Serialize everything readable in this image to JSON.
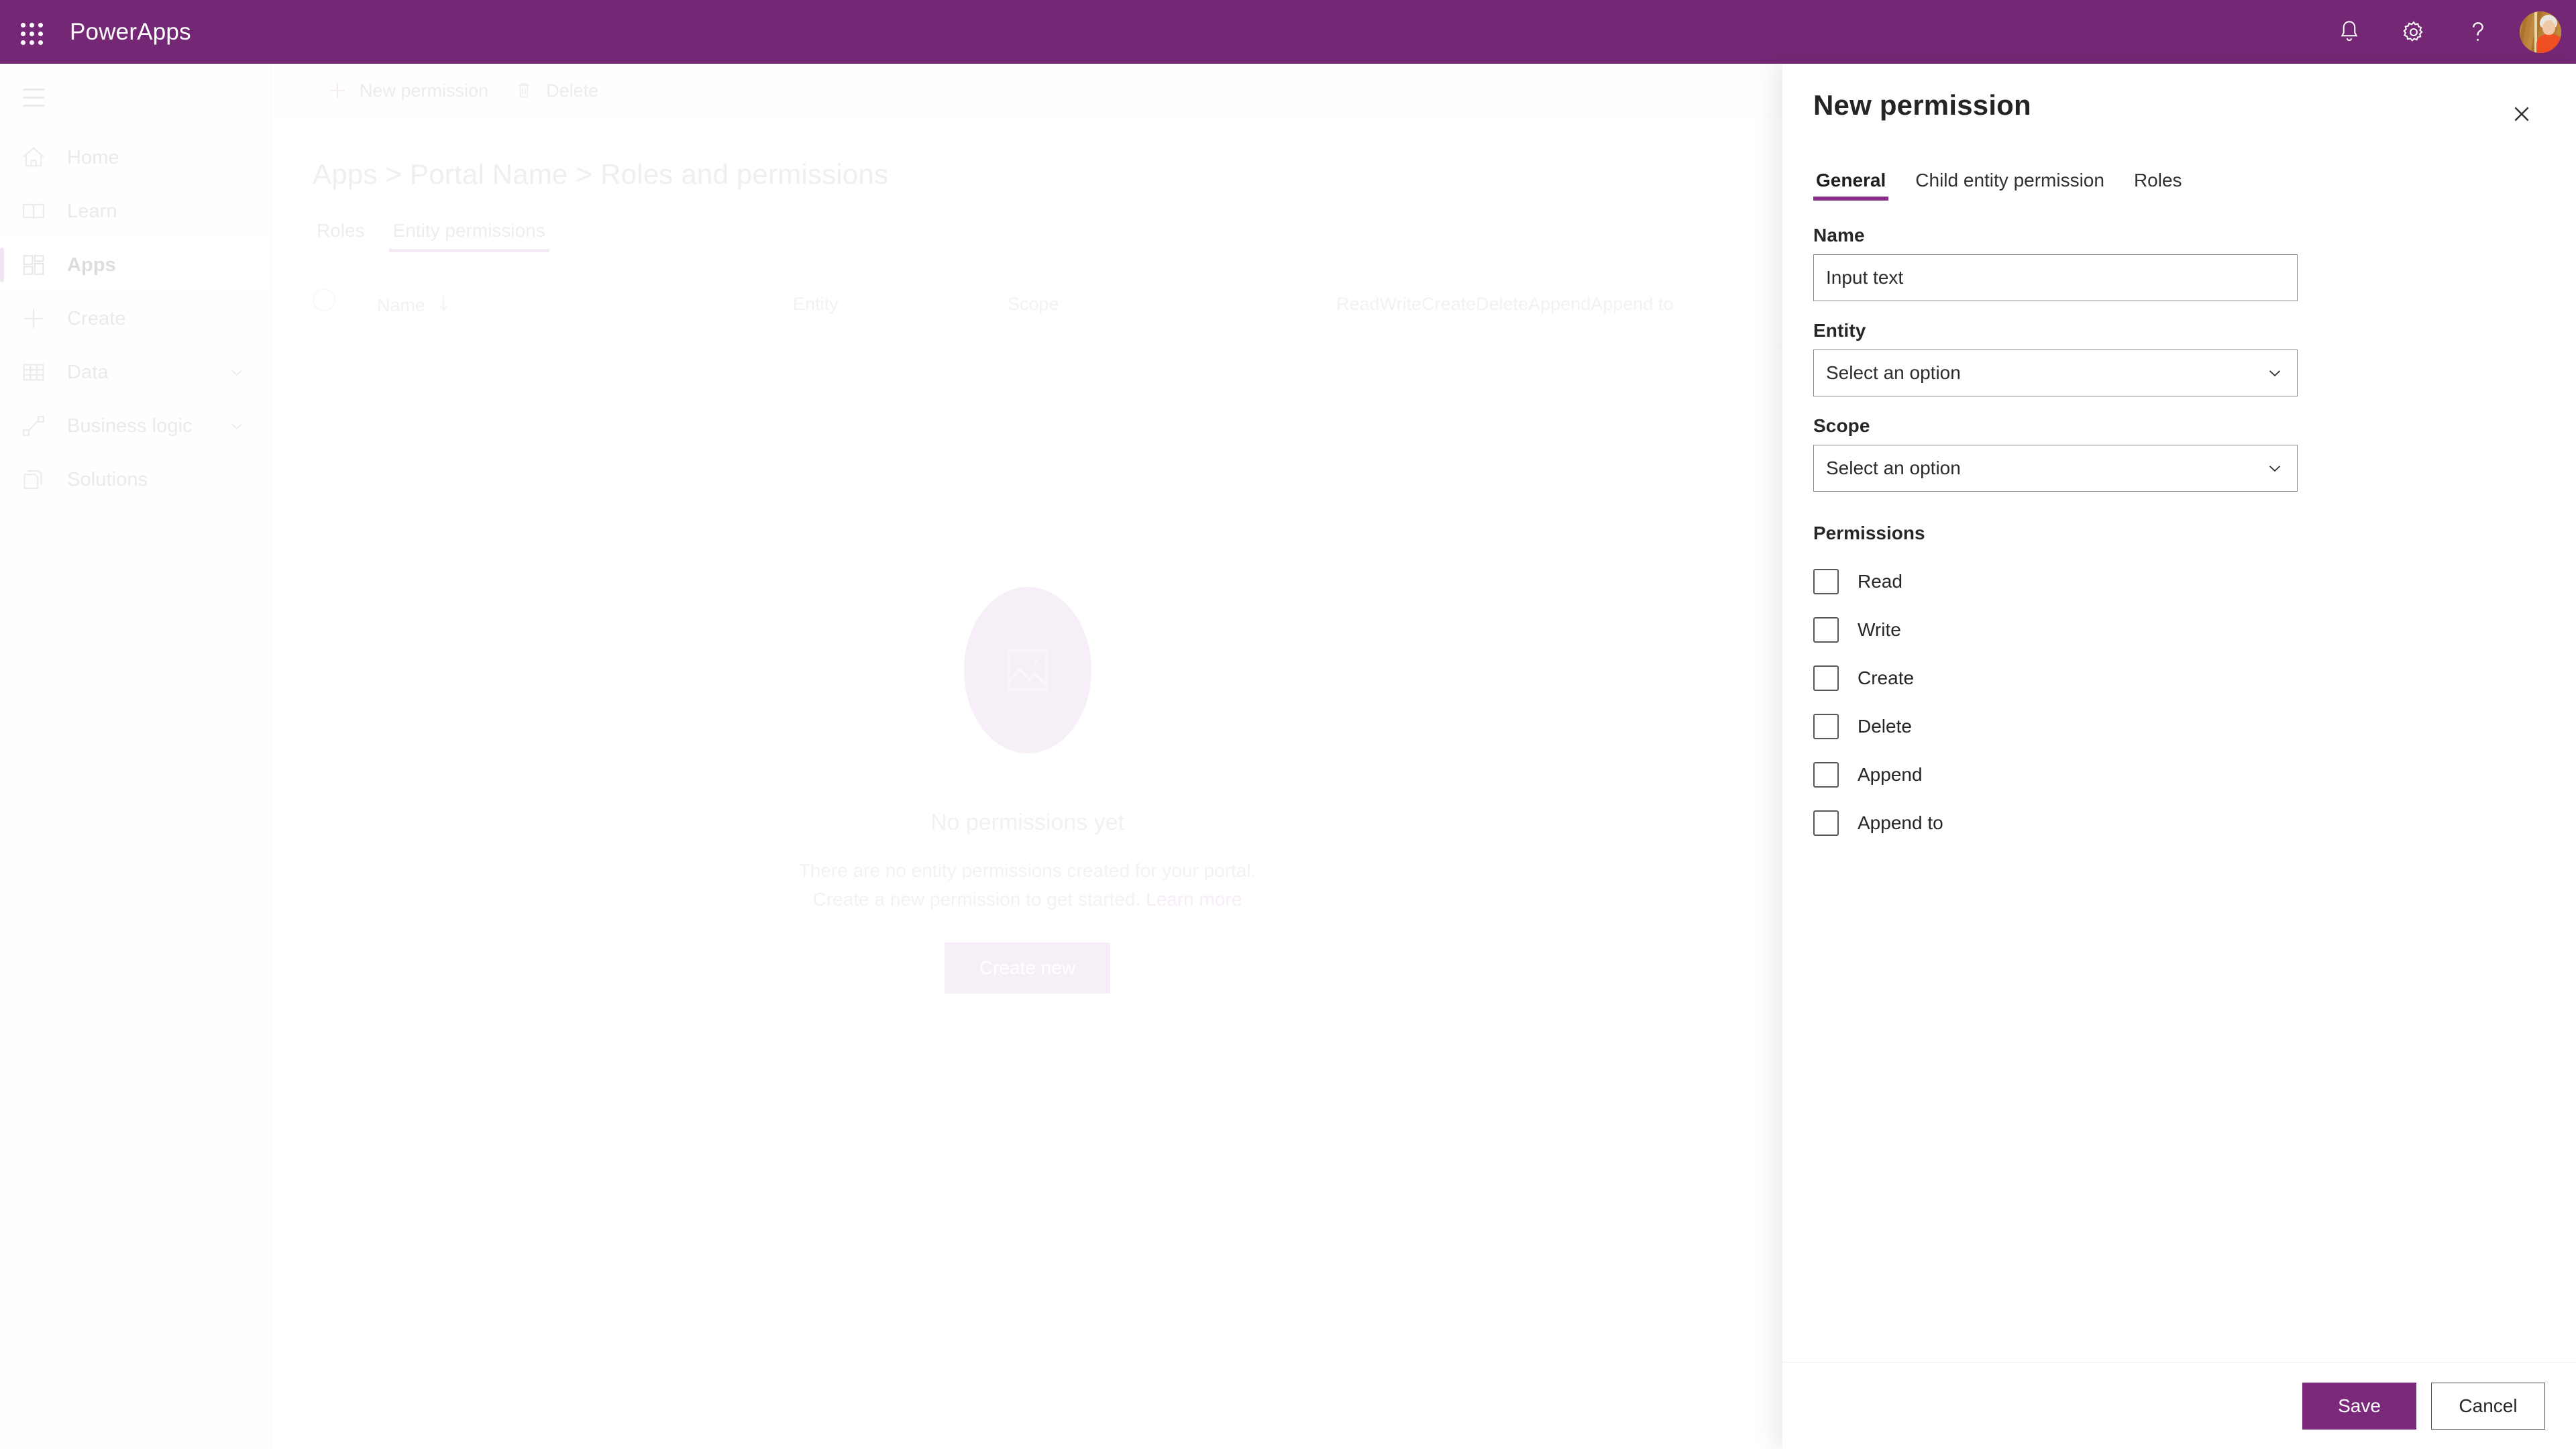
{
  "suite": {
    "waffle_icon": "app-launcher-icon",
    "title": "PowerApps",
    "notifications_icon": "bell-icon",
    "settings_icon": "gear-icon",
    "help_icon": "question-mark-icon",
    "avatar_icon": "user-avatar",
    "brand_color": "#742774"
  },
  "sidebar": {
    "menu_icon": "hamburger-icon",
    "items": [
      {
        "label": "Home",
        "icon": "home-icon",
        "active": false,
        "expandable": false
      },
      {
        "label": "Learn",
        "icon": "book-icon",
        "active": false,
        "expandable": false
      },
      {
        "label": "Apps",
        "icon": "apps-grid-icon",
        "active": true,
        "expandable": false
      },
      {
        "label": "Create",
        "icon": "plus-icon",
        "active": false,
        "expandable": false
      },
      {
        "label": "Data",
        "icon": "table-icon",
        "active": false,
        "expandable": true
      },
      {
        "label": "Business logic",
        "icon": "flow-icon",
        "active": false,
        "expandable": true
      },
      {
        "label": "Solutions",
        "icon": "solutions-icon",
        "active": false,
        "expandable": false
      }
    ]
  },
  "command_bar": {
    "new_permission": "New permission",
    "new_permission_icon": "plus-icon",
    "delete": "Delete",
    "delete_icon": "trash-icon"
  },
  "page": {
    "breadcrumb": "Apps > Portal Name > Roles and permissions",
    "tabs": [
      {
        "label": "Roles",
        "selected": false
      },
      {
        "label": "Entity permissions",
        "selected": true
      }
    ]
  },
  "table": {
    "select_all_icon": "select-all-circle",
    "sort_icon": "sort-descending-arrow",
    "columns": [
      "Name",
      "Entity",
      "Scope",
      "Read",
      "Write",
      "Create",
      "Delete",
      "Append",
      "Append to"
    ],
    "rows": []
  },
  "empty_state": {
    "illustration_icon": "image-placeholder-icon",
    "title": "No permissions yet",
    "description_line1": "There are no entity permissions created for your portal.",
    "description_line2": "Create a new permission to get started.",
    "link_text": "Learn more",
    "cta_label": "Create new"
  },
  "panel": {
    "title": "New permission",
    "close_icon": "close-x-icon",
    "tabs": [
      {
        "label": "General",
        "selected": true
      },
      {
        "label": "Child entity permission",
        "selected": false
      },
      {
        "label": "Roles",
        "selected": false
      }
    ],
    "fields": {
      "name_label": "Name",
      "name_value": "Input text",
      "name_placeholder": "Input text",
      "entity_label": "Entity",
      "entity_value": "Select an option",
      "scope_label": "Scope",
      "scope_value": "Select an option",
      "dropdown_icon": "chevron-down-icon"
    },
    "permissions": {
      "section_label": "Permissions",
      "items": [
        {
          "label": "Read",
          "checked": false
        },
        {
          "label": "Write",
          "checked": false
        },
        {
          "label": "Create",
          "checked": false
        },
        {
          "label": "Delete",
          "checked": false
        },
        {
          "label": "Append",
          "checked": false
        },
        {
          "label": "Append to",
          "checked": false
        }
      ]
    },
    "footer": {
      "save_label": "Save",
      "cancel_label": "Cancel",
      "save_color": "#7B2A7B"
    }
  }
}
